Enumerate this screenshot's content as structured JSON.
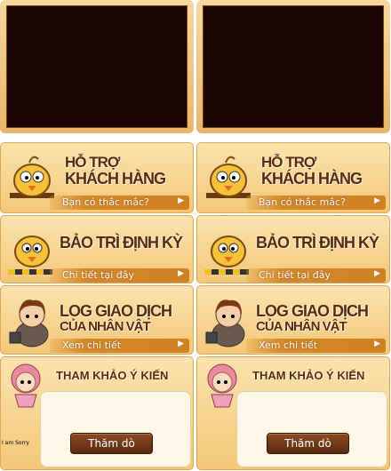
{
  "columns": [
    {
      "panels": {
        "support": {
          "title1": "HỖ TRỢ",
          "title2": "KHÁCH HÀNG",
          "link": "Bạn có thắc mắc?"
        },
        "maintenance": {
          "title1": "BẢO TRÌ ĐỊNH KỲ",
          "link": "Chi tiết tại đây"
        },
        "trade_log": {
          "title1": "LOG GIAO DỊCH",
          "title2": "CỦA NHÂN VẬT",
          "link": "Xem chi tiết"
        },
        "survey": {
          "title1": "THAM KHẢO Ý KIẾN",
          "button": "Thăm dò"
        }
      }
    },
    {
      "panels": {
        "support": {
          "title1": "HỖ TRỢ",
          "title2": "KHÁCH HÀNG",
          "link": "Bạn có thắc mắc?"
        },
        "maintenance": {
          "title1": "BẢO TRÌ ĐỊNH KỲ",
          "link": "Chi tiết tại đây"
        },
        "trade_log": {
          "title1": "LOG GIAO DỊCH",
          "title2": "CỦA NHÂN VẬT",
          "link": "Xem chi tiết"
        },
        "survey": {
          "title1": "THAM KHẢO Ý KIẾN",
          "button": "Thăm dò"
        }
      }
    }
  ],
  "misc": {
    "sorry_text": "I am Sorry"
  },
  "icons": {
    "arrow": "right-arrow-icon",
    "mascots": [
      "bird-mascot-support",
      "bird-mascot-maintenance",
      "character-trader",
      "character-girl-survey"
    ]
  },
  "colors": {
    "panel_bg": "#f3c778",
    "title": "#5b2a0e",
    "strip": "#cf8024",
    "video_screen": "#1a0503",
    "button": "#5b2a10"
  }
}
